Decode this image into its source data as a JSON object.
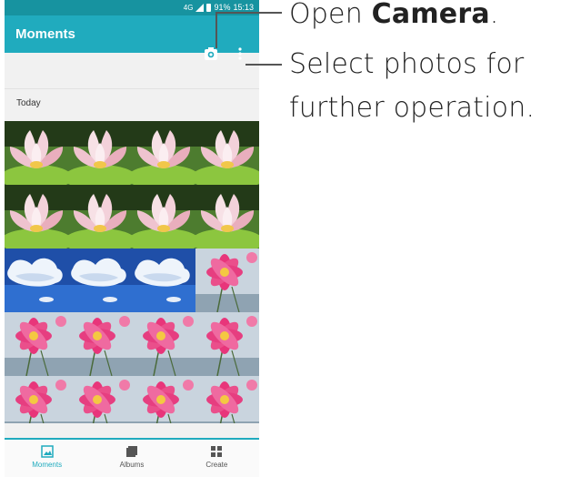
{
  "status_bar": {
    "network": "4G",
    "battery": "91%",
    "time": "15:13"
  },
  "app_bar": {
    "title": "Moments",
    "camera_icon": "camera-icon",
    "more_icon": "more-vert-icon"
  },
  "section": {
    "label": "Today"
  },
  "thumbnails": [
    [
      "lotus",
      "lotus",
      "lotus",
      "lotus"
    ],
    [
      "lotus",
      "lotus",
      "lotus",
      "lotus"
    ],
    [
      "sky",
      "sky",
      "sky",
      "cosmos"
    ],
    [
      "cosmos",
      "cosmos",
      "cosmos",
      "cosmos"
    ],
    [
      "cosmos",
      "cosmos",
      "cosmos",
      "cosmos"
    ]
  ],
  "bottom_nav": {
    "items": [
      {
        "label": "Moments",
        "icon": "image-icon",
        "active": true
      },
      {
        "label": "Albums",
        "icon": "albums-icon",
        "active": false
      },
      {
        "label": "Create",
        "icon": "create-icon",
        "active": false
      }
    ]
  },
  "callouts": {
    "camera": {
      "prefix": "Open ",
      "emphasis": "Camera",
      "suffix": "."
    },
    "select": {
      "line1": "Select photos for",
      "line2": "further operation."
    }
  },
  "colors": {
    "accent": "#20abbe",
    "status_bar": "#1793a0"
  }
}
